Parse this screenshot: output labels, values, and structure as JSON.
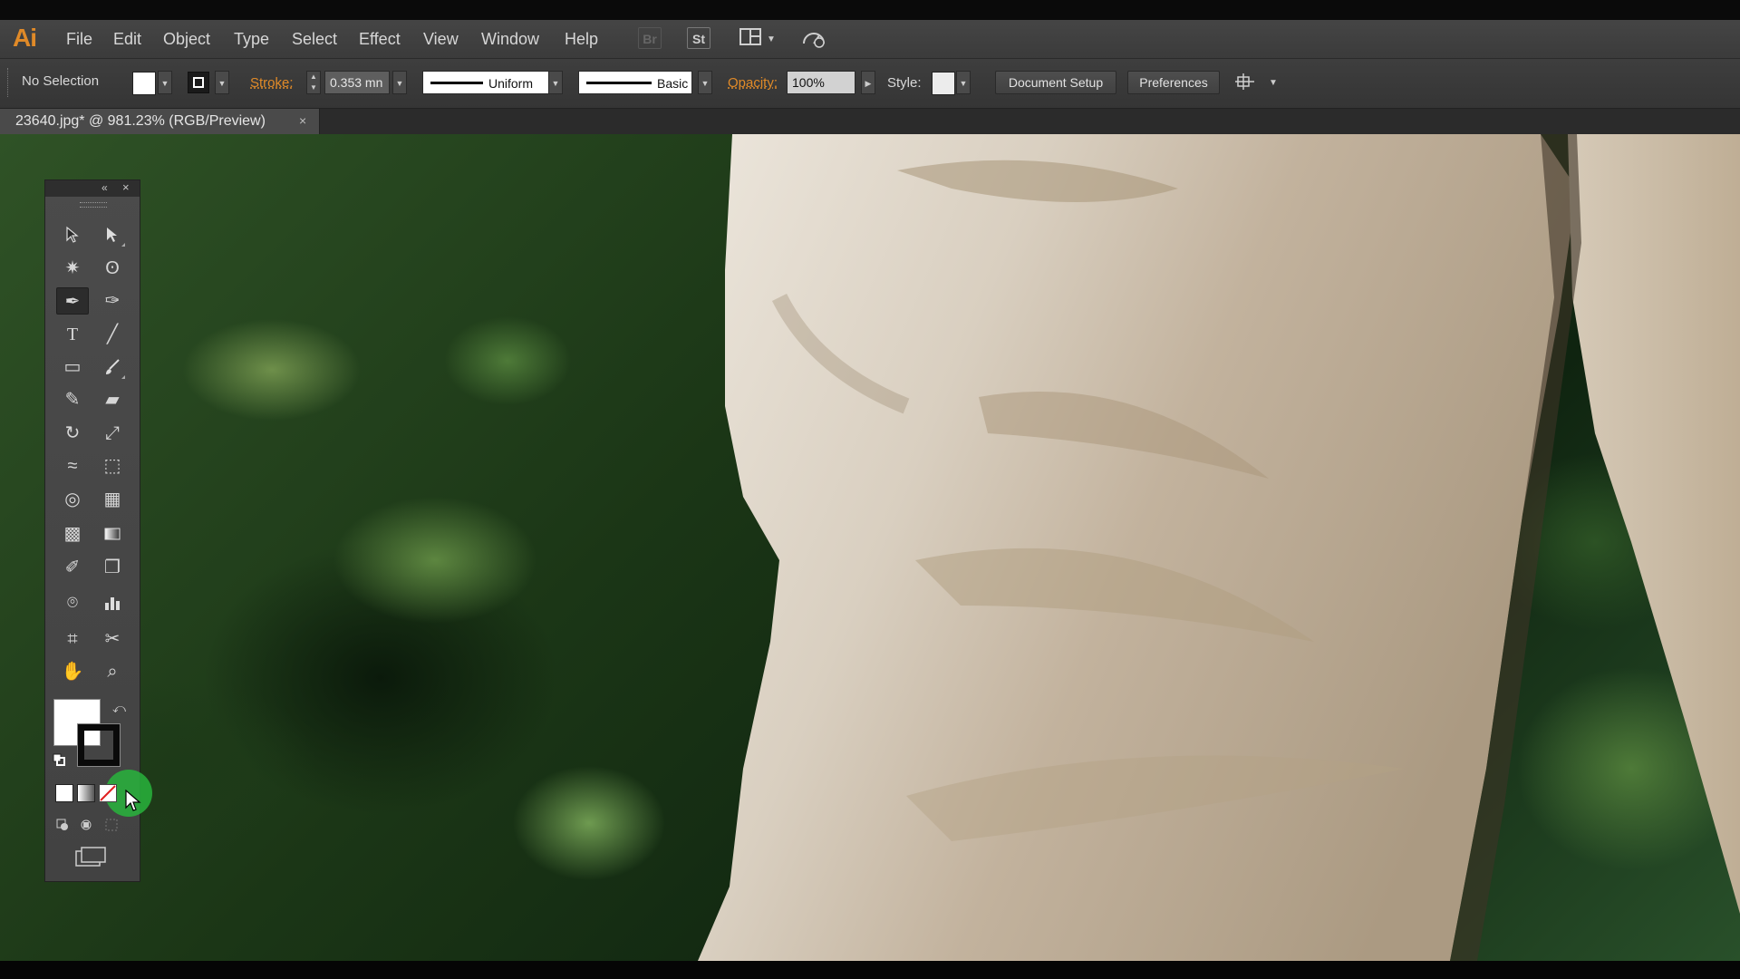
{
  "app": {
    "logo": "Ai",
    "menus": [
      "File",
      "Edit",
      "Object",
      "Type",
      "Select",
      "Effect",
      "View",
      "Window",
      "Help"
    ],
    "menu_icons": [
      {
        "name": "bridge-icon",
        "label": "Br"
      },
      {
        "name": "stock-icon",
        "label": "St"
      },
      {
        "name": "arrange-documents-icon",
        "label": ""
      },
      {
        "name": "gpu-performance-icon",
        "label": ""
      }
    ]
  },
  "control_bar": {
    "selection_status": "No Selection",
    "stroke_label": "Stroke:",
    "stroke_weight": "0.353 mn",
    "stroke_profile": "Uniform",
    "brush": "Basic",
    "opacity_label": "Opacity:",
    "opacity_value": "100%",
    "style_label": "Style:",
    "document_setup": "Document Setup",
    "preferences": "Preferences"
  },
  "document_tab": {
    "title": "23640.jpg* @ 981.23% (RGB/Preview)",
    "close": "×"
  },
  "toolbox": {
    "collapse": "«",
    "close": "×",
    "tools": [
      {
        "name": "selection-tool-icon",
        "glyph": "arrow-black"
      },
      {
        "name": "direct-selection-tool-icon",
        "glyph": "arrow-white"
      },
      {
        "name": "magic-wand-tool-icon",
        "glyph": "✷"
      },
      {
        "name": "lasso-tool-icon",
        "glyph": "ʘ"
      },
      {
        "name": "pen-tool-icon",
        "glyph": "✒"
      },
      {
        "name": "curvature-tool-icon",
        "glyph": "✑"
      },
      {
        "name": "type-tool-icon",
        "glyph": "T"
      },
      {
        "name": "line-segment-tool-icon",
        "glyph": "╱"
      },
      {
        "name": "rectangle-tool-icon",
        "glyph": "▭"
      },
      {
        "name": "paintbrush-tool-icon",
        "glyph": "🖌"
      },
      {
        "name": "pencil-tool-icon",
        "glyph": "✎"
      },
      {
        "name": "eraser-tool-icon",
        "glyph": "▰"
      },
      {
        "name": "rotate-tool-icon",
        "glyph": "↻"
      },
      {
        "name": "scale-tool-icon",
        "glyph": "⤢"
      },
      {
        "name": "width-tool-icon",
        "glyph": "≈"
      },
      {
        "name": "free-transform-tool-icon",
        "glyph": "⬚"
      },
      {
        "name": "shape-builder-tool-icon",
        "glyph": "◎"
      },
      {
        "name": "perspective-grid-tool-icon",
        "glyph": "▦"
      },
      {
        "name": "mesh-tool-icon",
        "glyph": "▩"
      },
      {
        "name": "gradient-tool-icon",
        "glyph": "▬"
      },
      {
        "name": "eyedropper-tool-icon",
        "glyph": "✐"
      },
      {
        "name": "blend-tool-icon",
        "glyph": "❐"
      },
      {
        "name": "symbol-sprayer-tool-icon",
        "glyph": "⌾"
      },
      {
        "name": "column-graph-tool-icon",
        "glyph": "▮"
      },
      {
        "name": "artboard-tool-icon",
        "glyph": "⌗"
      },
      {
        "name": "slice-tool-icon",
        "glyph": "✂"
      },
      {
        "name": "hand-tool-icon",
        "glyph": "✋"
      },
      {
        "name": "zoom-tool-icon",
        "glyph": "⌕"
      }
    ],
    "fill_color": "#ffffff",
    "stroke_color": "#0a0a0a",
    "highlight_color": "#28b43c"
  }
}
